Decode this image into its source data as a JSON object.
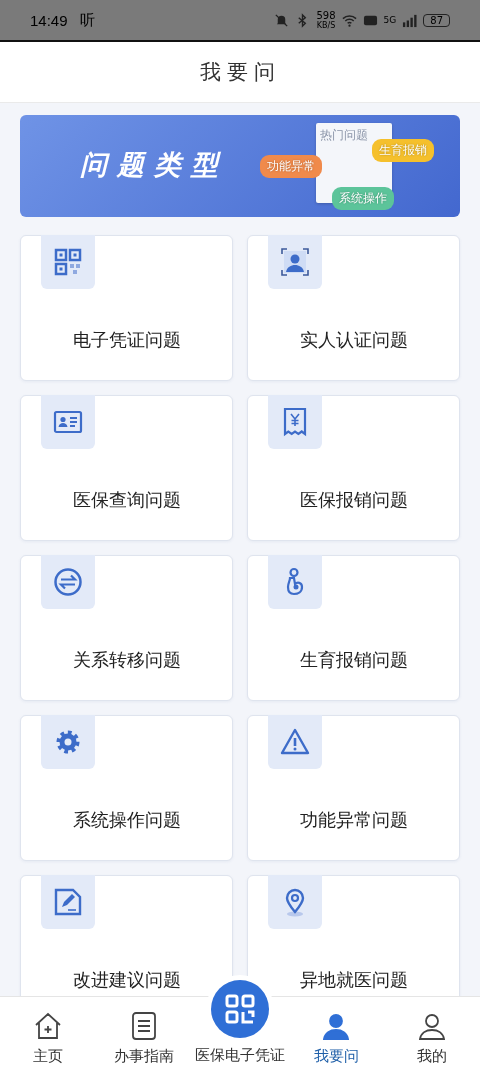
{
  "status_bar": {
    "time": "14:49",
    "app_glyph": "听",
    "speed": "598",
    "speed_unit": "KB/S",
    "network": "5G",
    "battery": "87"
  },
  "header": {
    "title": "我要问"
  },
  "banner": {
    "title": "问题类型",
    "sheet_title": "热门问题",
    "chips": [
      {
        "label": "功能异常",
        "color": "#f08a4b"
      },
      {
        "label": "生育报销",
        "color": "#f5c02c"
      },
      {
        "label": "系统操作",
        "color": "#5cc49a"
      }
    ]
  },
  "categories": [
    {
      "label": "电子凭证问题",
      "kind": "qr"
    },
    {
      "label": "实人认证问题",
      "kind": "person"
    },
    {
      "label": "医保查询问题",
      "kind": "card"
    },
    {
      "label": "医保报销问题",
      "kind": "receipt"
    },
    {
      "label": "关系转移问题",
      "kind": "exchange"
    },
    {
      "label": "生育报销问题",
      "kind": "maternity"
    },
    {
      "label": "系统操作问题",
      "kind": "gear"
    },
    {
      "label": "功能异常问题",
      "kind": "warning"
    },
    {
      "label": "改进建议问题",
      "kind": "edit"
    },
    {
      "label": "异地就医问题",
      "kind": "location"
    }
  ],
  "tab_bar": [
    {
      "label": "主页",
      "kind": "home",
      "selected": false
    },
    {
      "label": "办事指南",
      "kind": "guide",
      "selected": false
    },
    {
      "label": "医保电子凭证",
      "kind": "raised",
      "selected": false
    },
    {
      "label": "我要问",
      "kind": "ask",
      "selected": true
    },
    {
      "label": "我的",
      "kind": "user",
      "selected": false
    }
  ]
}
